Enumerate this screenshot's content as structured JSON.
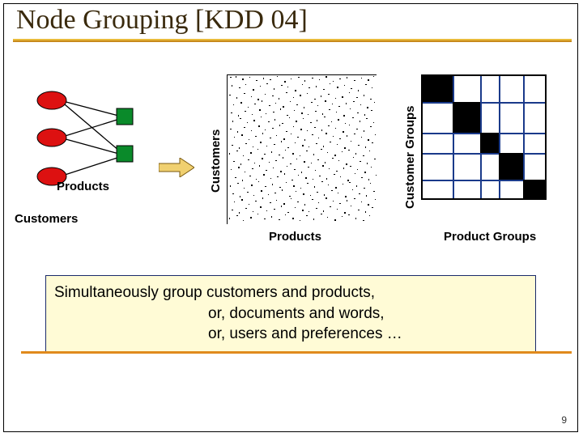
{
  "title": "Node Grouping [KDD 04]",
  "bipartite": {
    "customers_label": "Customers",
    "products_label": "Products"
  },
  "matrix_noise": {
    "ylabel": "Customers",
    "xlabel": "Products"
  },
  "matrix_block": {
    "ylabel": "Customer Groups",
    "xlabel": "Product Groups"
  },
  "callout": {
    "line1": "Simultaneously group customers and products,",
    "line2": "or,  documents and words,",
    "line3": "or,  users and preferences …"
  },
  "page_number": "9"
}
